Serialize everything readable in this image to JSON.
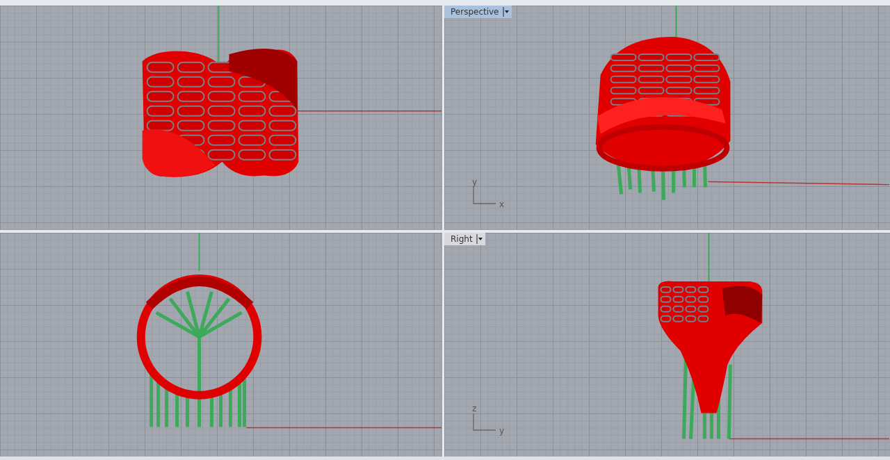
{
  "viewports": [
    {
      "kind": "band-side"
    },
    {
      "kind": "band-perspective",
      "title": {
        "label": "Perspective",
        "selected": true
      },
      "axes": {
        "vertical": "y",
        "horizontal": "x"
      }
    },
    {
      "kind": "ring-front"
    },
    {
      "kind": "band-right",
      "title": {
        "label": "Right",
        "selected": false
      },
      "axes": {
        "vertical": "z",
        "horizontal": "y"
      }
    }
  ]
}
